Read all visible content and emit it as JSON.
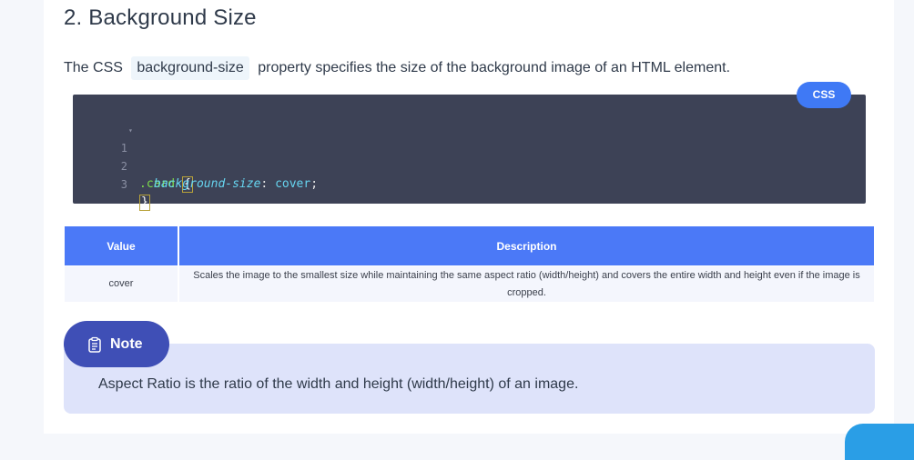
{
  "section": {
    "title": "2. Background Size"
  },
  "intro": {
    "prefix": "The CSS",
    "code": "background-size",
    "suffix": "property specifies the size of the background image of an HTML element."
  },
  "code_block": {
    "language_label": "CSS",
    "lines": [
      {
        "number": "1",
        "selector": ".card ",
        "open_brace": "{"
      },
      {
        "number": "2",
        "property": "background-size",
        "colon": ": ",
        "value": "cover",
        "semicolon": ";"
      },
      {
        "number": "3",
        "close_brace": "}"
      }
    ]
  },
  "table": {
    "headers": {
      "value": "Value",
      "description": "Description"
    },
    "rows": [
      {
        "value": "cover",
        "description": "Scales the image to the smallest size while maintaining the same aspect ratio (width/height) and covers the entire width and height even if the image is cropped."
      }
    ]
  },
  "note": {
    "label": "Note",
    "icon": "clipboard-icon",
    "text": "Aspect Ratio is the ratio of the width and height (width/height) of an image."
  },
  "colors": {
    "accent_blue": "#4b79f7",
    "note_pill": "#3f4fb6",
    "note_bg": "#dee3fa",
    "code_bg": "#3d4256"
  }
}
